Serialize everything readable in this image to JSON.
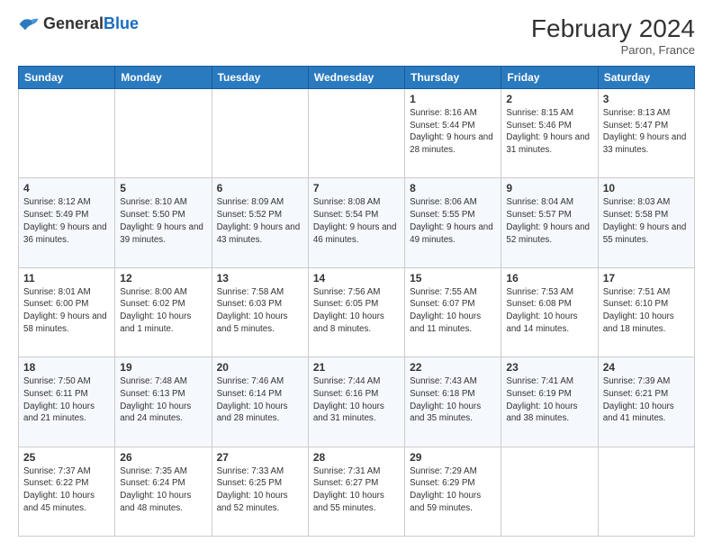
{
  "header": {
    "logo_general": "General",
    "logo_blue": "Blue",
    "month_year": "February 2024",
    "location": "Paron, France"
  },
  "days_of_week": [
    "Sunday",
    "Monday",
    "Tuesday",
    "Wednesday",
    "Thursday",
    "Friday",
    "Saturday"
  ],
  "weeks": [
    [
      {
        "day": "",
        "info": ""
      },
      {
        "day": "",
        "info": ""
      },
      {
        "day": "",
        "info": ""
      },
      {
        "day": "",
        "info": ""
      },
      {
        "day": "1",
        "info": "Sunrise: 8:16 AM\nSunset: 5:44 PM\nDaylight: 9 hours and 28 minutes."
      },
      {
        "day": "2",
        "info": "Sunrise: 8:15 AM\nSunset: 5:46 PM\nDaylight: 9 hours and 31 minutes."
      },
      {
        "day": "3",
        "info": "Sunrise: 8:13 AM\nSunset: 5:47 PM\nDaylight: 9 hours and 33 minutes."
      }
    ],
    [
      {
        "day": "4",
        "info": "Sunrise: 8:12 AM\nSunset: 5:49 PM\nDaylight: 9 hours and 36 minutes."
      },
      {
        "day": "5",
        "info": "Sunrise: 8:10 AM\nSunset: 5:50 PM\nDaylight: 9 hours and 39 minutes."
      },
      {
        "day": "6",
        "info": "Sunrise: 8:09 AM\nSunset: 5:52 PM\nDaylight: 9 hours and 43 minutes."
      },
      {
        "day": "7",
        "info": "Sunrise: 8:08 AM\nSunset: 5:54 PM\nDaylight: 9 hours and 46 minutes."
      },
      {
        "day": "8",
        "info": "Sunrise: 8:06 AM\nSunset: 5:55 PM\nDaylight: 9 hours and 49 minutes."
      },
      {
        "day": "9",
        "info": "Sunrise: 8:04 AM\nSunset: 5:57 PM\nDaylight: 9 hours and 52 minutes."
      },
      {
        "day": "10",
        "info": "Sunrise: 8:03 AM\nSunset: 5:58 PM\nDaylight: 9 hours and 55 minutes."
      }
    ],
    [
      {
        "day": "11",
        "info": "Sunrise: 8:01 AM\nSunset: 6:00 PM\nDaylight: 9 hours and 58 minutes."
      },
      {
        "day": "12",
        "info": "Sunrise: 8:00 AM\nSunset: 6:02 PM\nDaylight: 10 hours and 1 minute."
      },
      {
        "day": "13",
        "info": "Sunrise: 7:58 AM\nSunset: 6:03 PM\nDaylight: 10 hours and 5 minutes."
      },
      {
        "day": "14",
        "info": "Sunrise: 7:56 AM\nSunset: 6:05 PM\nDaylight: 10 hours and 8 minutes."
      },
      {
        "day": "15",
        "info": "Sunrise: 7:55 AM\nSunset: 6:07 PM\nDaylight: 10 hours and 11 minutes."
      },
      {
        "day": "16",
        "info": "Sunrise: 7:53 AM\nSunset: 6:08 PM\nDaylight: 10 hours and 14 minutes."
      },
      {
        "day": "17",
        "info": "Sunrise: 7:51 AM\nSunset: 6:10 PM\nDaylight: 10 hours and 18 minutes."
      }
    ],
    [
      {
        "day": "18",
        "info": "Sunrise: 7:50 AM\nSunset: 6:11 PM\nDaylight: 10 hours and 21 minutes."
      },
      {
        "day": "19",
        "info": "Sunrise: 7:48 AM\nSunset: 6:13 PM\nDaylight: 10 hours and 24 minutes."
      },
      {
        "day": "20",
        "info": "Sunrise: 7:46 AM\nSunset: 6:14 PM\nDaylight: 10 hours and 28 minutes."
      },
      {
        "day": "21",
        "info": "Sunrise: 7:44 AM\nSunset: 6:16 PM\nDaylight: 10 hours and 31 minutes."
      },
      {
        "day": "22",
        "info": "Sunrise: 7:43 AM\nSunset: 6:18 PM\nDaylight: 10 hours and 35 minutes."
      },
      {
        "day": "23",
        "info": "Sunrise: 7:41 AM\nSunset: 6:19 PM\nDaylight: 10 hours and 38 minutes."
      },
      {
        "day": "24",
        "info": "Sunrise: 7:39 AM\nSunset: 6:21 PM\nDaylight: 10 hours and 41 minutes."
      }
    ],
    [
      {
        "day": "25",
        "info": "Sunrise: 7:37 AM\nSunset: 6:22 PM\nDaylight: 10 hours and 45 minutes."
      },
      {
        "day": "26",
        "info": "Sunrise: 7:35 AM\nSunset: 6:24 PM\nDaylight: 10 hours and 48 minutes."
      },
      {
        "day": "27",
        "info": "Sunrise: 7:33 AM\nSunset: 6:25 PM\nDaylight: 10 hours and 52 minutes."
      },
      {
        "day": "28",
        "info": "Sunrise: 7:31 AM\nSunset: 6:27 PM\nDaylight: 10 hours and 55 minutes."
      },
      {
        "day": "29",
        "info": "Sunrise: 7:29 AM\nSunset: 6:29 PM\nDaylight: 10 hours and 59 minutes."
      },
      {
        "day": "",
        "info": ""
      },
      {
        "day": "",
        "info": ""
      }
    ]
  ]
}
